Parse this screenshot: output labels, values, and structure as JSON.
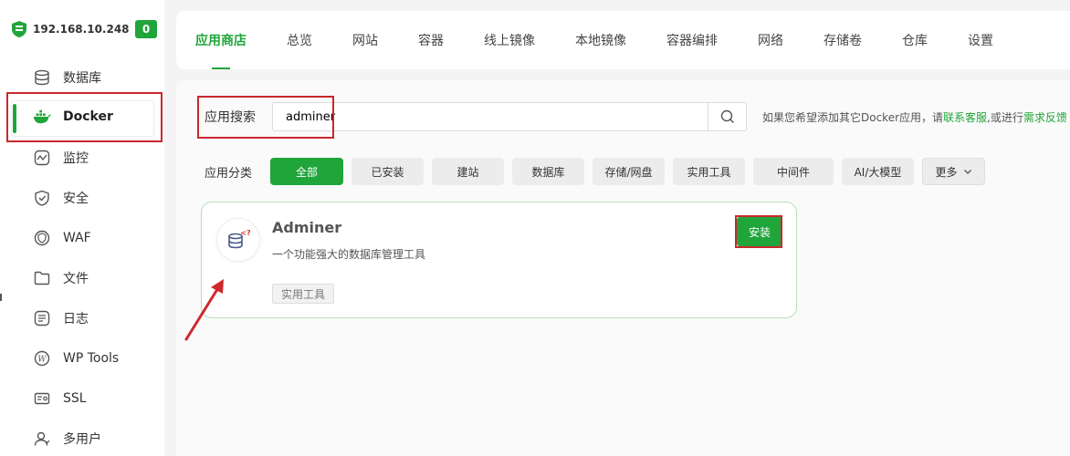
{
  "server": {
    "ip": "192.168.10.248",
    "badge": "0"
  },
  "sidebar": {
    "items": [
      {
        "label": "数据库",
        "icon": "database-icon"
      },
      {
        "label": "Docker",
        "icon": "docker-icon"
      },
      {
        "label": "监控",
        "icon": "monitor-icon"
      },
      {
        "label": "安全",
        "icon": "shield-icon"
      },
      {
        "label": "WAF",
        "icon": "waf-icon"
      },
      {
        "label": "文件",
        "icon": "folder-icon"
      },
      {
        "label": "日志",
        "icon": "log-icon"
      },
      {
        "label": "WP Tools",
        "icon": "wordpress-icon"
      },
      {
        "label": "SSL",
        "icon": "ssl-icon"
      },
      {
        "label": "多用户",
        "icon": "users-icon"
      }
    ]
  },
  "tabs": [
    "应用商店",
    "总览",
    "网站",
    "容器",
    "线上镜像",
    "本地镜像",
    "容器编排",
    "网络",
    "存储卷",
    "仓库",
    "设置"
  ],
  "search": {
    "label": "应用搜索",
    "value": "adminer",
    "hint_prefix": "如果您希望添加其它Docker应用，请",
    "hint_link1": "联系客服",
    "hint_mid": ",或进行",
    "hint_link2": "需求反馈"
  },
  "categories": {
    "label": "应用分类",
    "items": [
      "全部",
      "已安装",
      "建站",
      "数据库",
      "存储/网盘",
      "实用工具",
      "中间件",
      "AI/大模型",
      "更多"
    ]
  },
  "app": {
    "name": "Adminer",
    "desc": "一个功能强大的数据库管理工具",
    "tag": "实用工具",
    "install": "安装"
  },
  "colors": {
    "accent": "#20a53a",
    "highlight": "#c9282d"
  }
}
